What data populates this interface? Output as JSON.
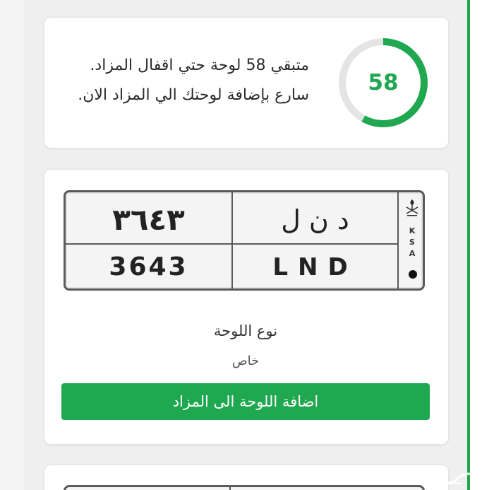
{
  "countdown": {
    "remaining": "58",
    "progress_percent": 58,
    "message_line1": "متبقي 58 لوحة حتي اقفال المزاد.",
    "message_line2": "سارع بإضافة لوحتك الي المزاد الان.",
    "ring_color": "#1fa84f",
    "ring_track_color": "#e4e4e4"
  },
  "plate": {
    "arabic_numbers": "٣٦٤٣",
    "arabic_letters": "د ن ل",
    "english_numbers": "3643",
    "english_letters": "LND",
    "country_letters": [
      "K",
      "S",
      "A"
    ],
    "emblem_icon": "saudi-emblem-icon",
    "type_label": "نوع اللوحة",
    "type_value": "خاص"
  },
  "actions": {
    "add_to_auction_label": "اضافة اللوحة الى المزاد"
  },
  "colors": {
    "accent": "#1fa84f"
  }
}
